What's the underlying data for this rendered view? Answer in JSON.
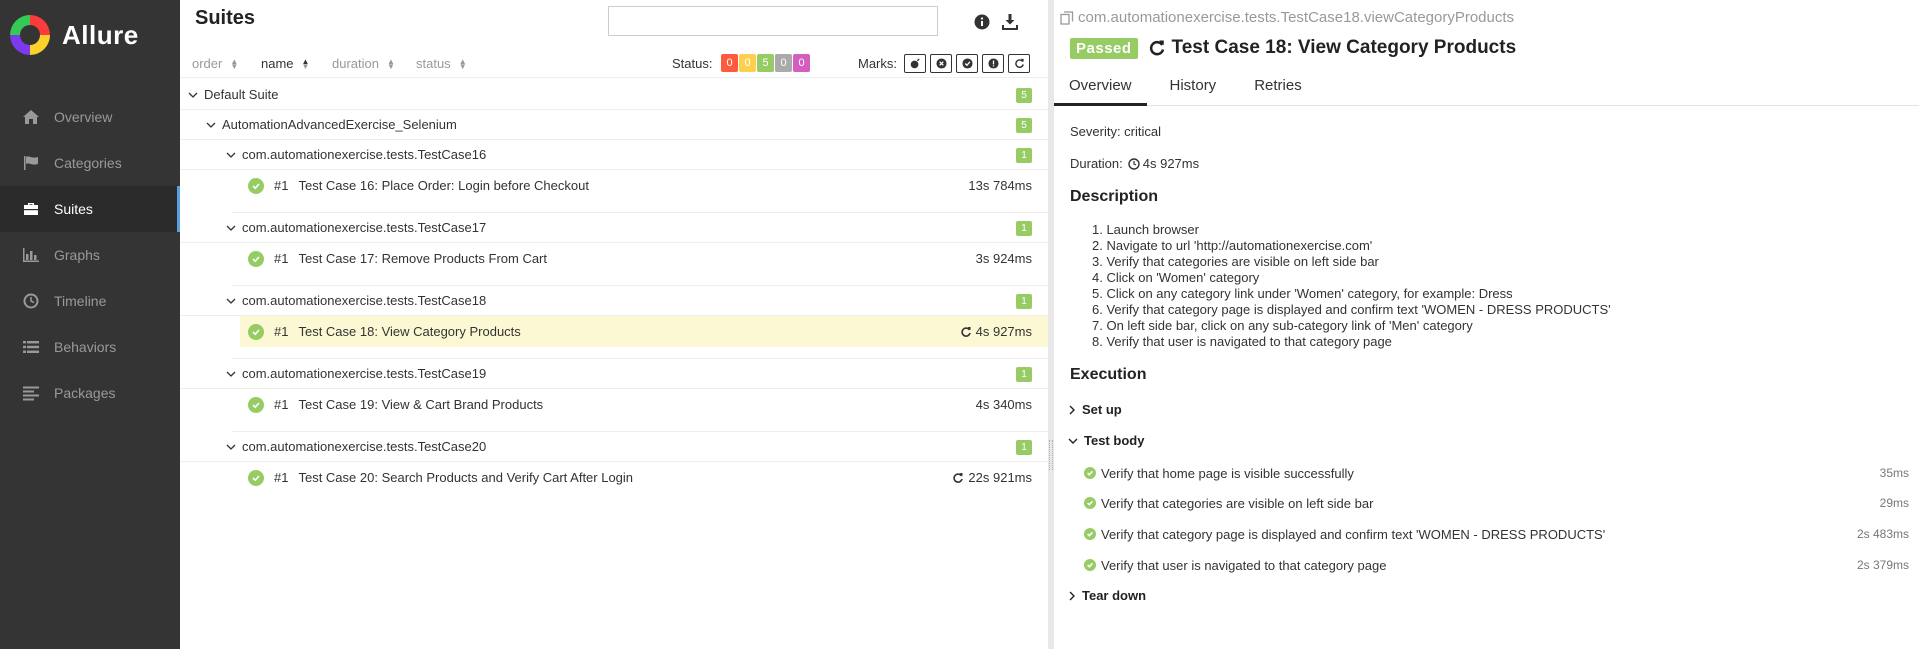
{
  "app": {
    "name": "Allure"
  },
  "sidebar": {
    "items": [
      {
        "label": "Overview",
        "icon": "home-icon"
      },
      {
        "label": "Categories",
        "icon": "flag-icon"
      },
      {
        "label": "Suites",
        "icon": "briefcase-icon",
        "active": true
      },
      {
        "label": "Graphs",
        "icon": "bar-chart-icon"
      },
      {
        "label": "Timeline",
        "icon": "clock-icon"
      },
      {
        "label": "Behaviors",
        "icon": "list-icon"
      },
      {
        "label": "Packages",
        "icon": "align-left-icon"
      }
    ]
  },
  "suites": {
    "title": "Suites",
    "search_value": "",
    "sort": {
      "order": "order",
      "name": "name",
      "duration": "duration",
      "status": "status"
    },
    "status_label": "Status:",
    "status_counts": [
      {
        "value": "0",
        "color": "#fd5a3e"
      },
      {
        "value": "0",
        "color": "#ffd050"
      },
      {
        "value": "5",
        "color": "#97cc64"
      },
      {
        "value": "0",
        "color": "#aaaaaa"
      },
      {
        "value": "0",
        "color": "#d35ebe"
      }
    ],
    "marks_label": "Marks:",
    "root": {
      "label": "Default Suite",
      "count": "5"
    },
    "sub": {
      "label": "AutomationAdvancedExercise_Selenium",
      "count": "5"
    },
    "groups": [
      {
        "label": "com.automationexercise.tests.TestCase16",
        "count": "1",
        "test": {
          "num": "#1",
          "name": "Test Case 16: Place Order: Login before Checkout",
          "duration": "13s 784ms",
          "retried": false,
          "selected": false
        }
      },
      {
        "label": "com.automationexercise.tests.TestCase17",
        "count": "1",
        "test": {
          "num": "#1",
          "name": "Test Case 17: Remove Products From Cart",
          "duration": "3s 924ms",
          "retried": false,
          "selected": false
        }
      },
      {
        "label": "com.automationexercise.tests.TestCase18",
        "count": "1",
        "test": {
          "num": "#1",
          "name": "Test Case 18: View Category Products",
          "duration": "4s 927ms",
          "retried": true,
          "selected": true
        }
      },
      {
        "label": "com.automationexercise.tests.TestCase19",
        "count": "1",
        "test": {
          "num": "#1",
          "name": "Test Case 19: View & Cart Brand Products",
          "duration": "4s 340ms",
          "retried": false,
          "selected": false
        }
      },
      {
        "label": "com.automationexercise.tests.TestCase20",
        "count": "1",
        "test": {
          "num": "#1",
          "name": "Test Case 20: Search Products and Verify Cart After Login",
          "duration": "22s 921ms",
          "retried": true,
          "selected": false
        }
      }
    ]
  },
  "detail": {
    "path": "com.automationexercise.tests.TestCase18.viewCategoryProducts",
    "status": "Passed",
    "title": "Test Case 18: View Category Products",
    "tabs": [
      "Overview",
      "History",
      "Retries"
    ],
    "severity": "Severity: critical",
    "duration_label": "Duration:",
    "duration": "4s 927ms",
    "description_title": "Description",
    "description": [
      "1. Launch browser",
      "2. Navigate to url 'http://automationexercise.com'",
      "3. Verify that categories are visible on left side bar",
      "4. Click on 'Women' category",
      "5. Click on any category link under 'Women' category, for example: Dress",
      "6. Verify that category page is displayed and confirm text 'WOMEN - DRESS PRODUCTS'",
      "7. On left side bar, click on any sub-category link of 'Men' category",
      "8. Verify that user is navigated to that category page"
    ],
    "execution_title": "Execution",
    "setup": "Set up",
    "body": "Test body",
    "teardown": "Tear down",
    "steps": [
      {
        "name": "Verify that home page is visible successfully",
        "duration": "35ms"
      },
      {
        "name": "Verify that categories are visible on left side bar",
        "duration": "29ms"
      },
      {
        "name": "Verify that category page is displayed and confirm text 'WOMEN - DRESS PRODUCTS'",
        "duration": "2s 483ms"
      },
      {
        "name": "Verify that user is navigated to that category page",
        "duration": "2s 379ms"
      }
    ]
  }
}
